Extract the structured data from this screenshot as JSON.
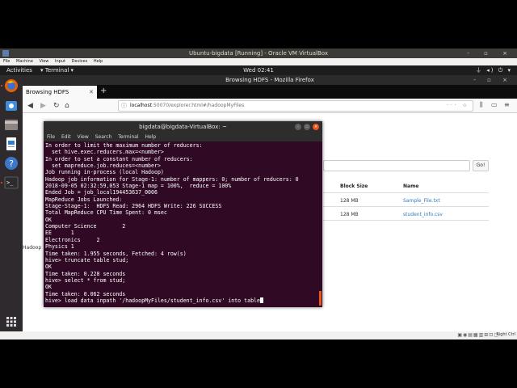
{
  "vbox": {
    "title": "Ubuntu-bigdata [Running] - Oracle VM VirtualBox",
    "window_controls": "- ▫ ×",
    "menu": [
      "File",
      "Machine",
      "View",
      "Input",
      "Devices",
      "Help"
    ],
    "hostkey_label": "Right Ctrl"
  },
  "topbar": {
    "activities": "Activities",
    "app": "▾ Terminal ▾",
    "clock": "Wed 02:41",
    "tray": "⏚ ◂) ⏻ ▾"
  },
  "firefox": {
    "window_title": "Browsing HDFS - Mozilla Firefox",
    "window_controls": "- ▫ ×",
    "tab_title": "Browsing HDFS",
    "url_host": "localhost",
    "url_path": ":50070/explorer.html#/hadoopMyFiles"
  },
  "hdfs": {
    "go_label": "Go!",
    "columns": {
      "block_size": "Block Size",
      "name": "Name"
    },
    "rows": [
      {
        "block_size": "128 MB",
        "name": "Sample_File.txt"
      },
      {
        "block_size": "128 MB",
        "name": "student_info.csv"
      }
    ],
    "hadoop_label": "Hadoop"
  },
  "terminal": {
    "title": "bigdata@bigdata-VirtualBox: ~",
    "menu": [
      "File",
      "Edit",
      "View",
      "Search",
      "Terminal",
      "Help"
    ],
    "lines": [
      "In order to limit the maximum number of reducers:",
      "  set hive.exec.reducers.max=<number>",
      "In order to set a constant number of reducers:",
      "  set mapreduce.job.reduces=<number>",
      "Job running in-process (local Hadoop)",
      "Hadoop job information for Stage-1: number of mappers: 0; number of reducers: 0",
      "2018-09-05 02:32:59,053 Stage-1 map = 100%,  reduce = 100%",
      "Ended Job = job_local194453637_0006",
      "MapReduce Jobs Launched:",
      "Stage-Stage-1:  HDFS Read: 2964 HDFS Write: 226 SUCCESS",
      "Total MapReduce CPU Time Spent: 0 msec",
      "OK",
      "Computer Science        2",
      "EE      1",
      "Electronics     2",
      "Physics 1",
      "Time taken: 1.955 seconds, Fetched: 4 row(s)",
      "hive> truncate table stud;",
      "OK",
      "Time taken: 0.228 seconds",
      "hive> select * from stud;",
      "OK",
      "Time taken: 0.062 seconds"
    ],
    "prompt_line": "hive> load data inpath '/hadoopMyFiles/student_info.csv' into table"
  },
  "colors": {
    "terminal_bg": "#300a24",
    "ubuntu_orange": "#e95420",
    "link": "#337ab7"
  },
  "icons": [
    "firefox-icon",
    "ubuntu-software-icon",
    "files-icon",
    "libreoffice-writer-icon",
    "help-icon",
    "terminal-icon",
    "show-apps-icon"
  ]
}
